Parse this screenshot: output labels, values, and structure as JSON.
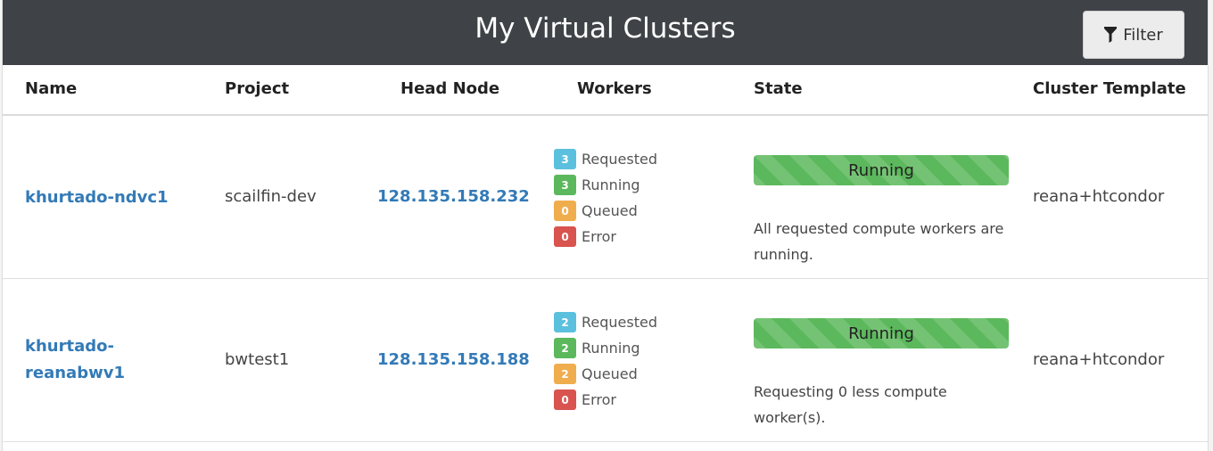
{
  "header": {
    "title": "My Virtual Clusters",
    "filter_label": "Filter"
  },
  "table": {
    "columns": [
      "Name",
      "Project",
      "Head Node",
      "Workers",
      "State",
      "Cluster Template"
    ],
    "rows": [
      {
        "name_lines": [
          "khurtado-ndvc1"
        ],
        "project": "scailfin-dev",
        "head_node": "128.135.158.232",
        "workers": [
          {
            "count": "3",
            "label": "Requested",
            "color": "#5bc0de"
          },
          {
            "count": "3",
            "label": "Running",
            "color": "#5cb85c"
          },
          {
            "count": "0",
            "label": "Queued",
            "color": "#f0ad4e"
          },
          {
            "count": "0",
            "label": "Error",
            "color": "#d9534f"
          }
        ],
        "state": {
          "label": "Running",
          "progress": 1.0,
          "message": "All requested compute workers are running."
        },
        "template": "reana+htcondor"
      },
      {
        "name_lines": [
          "khurtado-",
          "reanabwv1"
        ],
        "project": "bwtest1",
        "head_node": "128.135.158.188",
        "workers": [
          {
            "count": "2",
            "label": "Requested",
            "color": "#5bc0de"
          },
          {
            "count": "2",
            "label": "Running",
            "color": "#5cb85c"
          },
          {
            "count": "2",
            "label": "Queued",
            "color": "#f0ad4e"
          },
          {
            "count": "0",
            "label": "Error",
            "color": "#d9534f"
          }
        ],
        "state": {
          "label": "Running",
          "progress": 1.0,
          "message": "Requesting 0 less compute worker(s)."
        },
        "template": "reana+htcondor"
      }
    ]
  }
}
